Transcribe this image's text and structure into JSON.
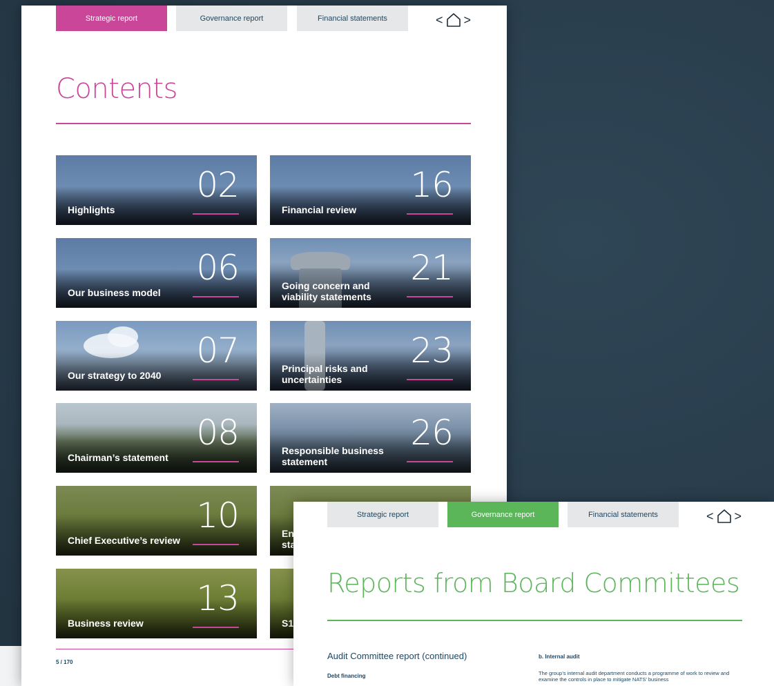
{
  "page1": {
    "tabs": [
      {
        "label": "Strategic report",
        "active": true
      },
      {
        "label": "Governance report",
        "active": false
      },
      {
        "label": "Financial statements",
        "active": false
      }
    ],
    "nav": {
      "prev": "<",
      "next": ">",
      "home_icon": "home-icon"
    },
    "title": "Contents",
    "accent_color": "#c94699",
    "tiles": [
      {
        "num": "02",
        "label": "Highlights"
      },
      {
        "num": "16",
        "label": "Financial review"
      },
      {
        "num": "06",
        "label": "Our business model"
      },
      {
        "num": "21",
        "label": "Going concern and viability statements"
      },
      {
        "num": "07",
        "label": "Our strategy to 2040"
      },
      {
        "num": "23",
        "label": "Principal risks and uncertainties"
      },
      {
        "num": "08",
        "label": "Chairman’s statement"
      },
      {
        "num": "26",
        "label": "Responsible business statement"
      },
      {
        "num": "10",
        "label": "Chief Executive’s review"
      },
      {
        "label_partial": "En\nsta"
      },
      {
        "num": "13",
        "label": "Business review"
      },
      {
        "label_partial": "S1"
      }
    ],
    "page_number": "5 / 170"
  },
  "page2": {
    "tabs": [
      {
        "label": "Strategic report",
        "active": false
      },
      {
        "label": "Governance report",
        "active": true
      },
      {
        "label": "Financial statements",
        "active": false
      }
    ],
    "nav": {
      "prev": "<",
      "next": ">",
      "home_icon": "home-icon"
    },
    "title": "Reports from Board Committees",
    "accent_color": "#5bb65a",
    "section_heading": "Audit Committee report (continued)",
    "subheading": "Debt financing",
    "right_heading": "b. Internal audit",
    "right_body": "The group’s internal audit department conducts a programme of work to review and examine the controls in place to mitigate NATS’ business"
  }
}
